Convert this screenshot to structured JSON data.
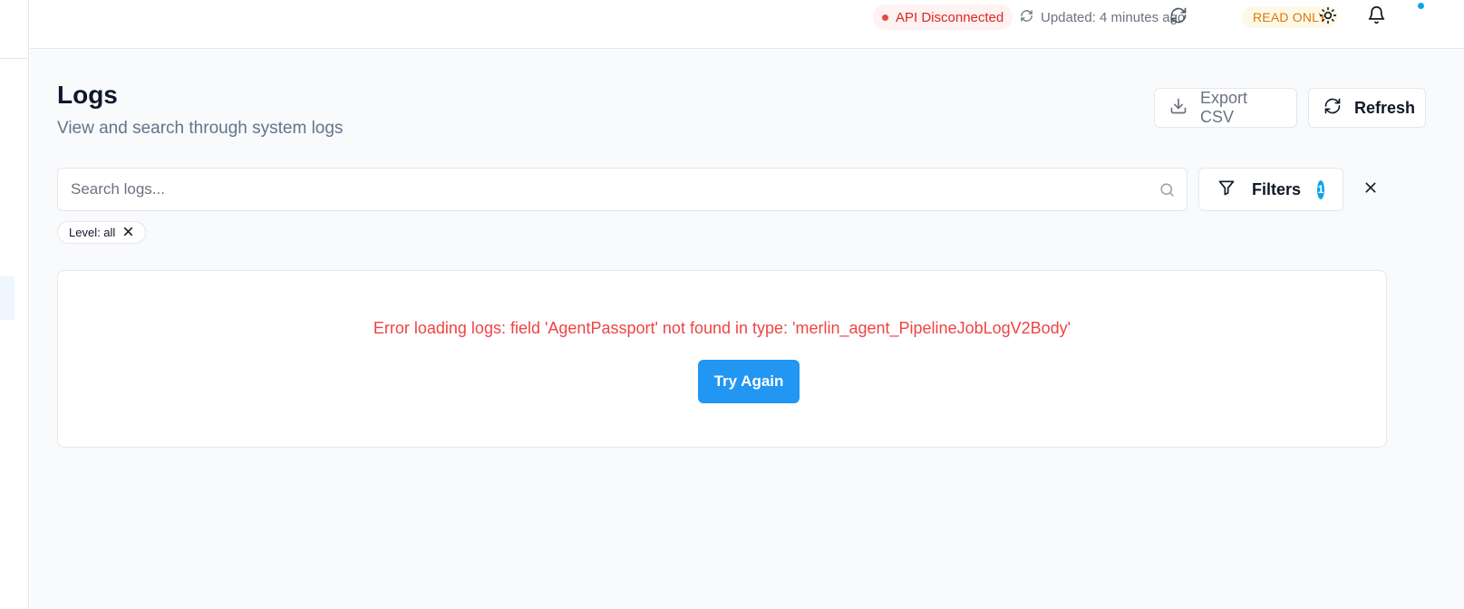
{
  "topbar": {
    "api_status": "API Disconnected",
    "updated_text": "Updated: 4 minutes ago",
    "read_only_label": "READ ONLY",
    "notification_dot_color": "#0ea5e9",
    "icons": [
      "sync-icon",
      "refresh-icon",
      "sun-icon",
      "bell-icon"
    ]
  },
  "page": {
    "title": "Logs",
    "subtitle": "View and search through system logs"
  },
  "actions": {
    "export_label": "Export CSV",
    "refresh_label": "Refresh"
  },
  "search": {
    "placeholder": "Search logs...",
    "value": ""
  },
  "filters": {
    "label": "Filters",
    "count": "1",
    "active_chips": [
      {
        "label": "Level: all"
      }
    ]
  },
  "error": {
    "message": "Error loading logs: field 'AgentPassport' not found in type: 'merlin_agent_PipelineJobLogV2Body'",
    "retry_label": "Try Again"
  },
  "colors": {
    "accent": "#2196f3",
    "error": "#ef4444",
    "warning": "#d97706",
    "badge": "#0ea5e9"
  }
}
